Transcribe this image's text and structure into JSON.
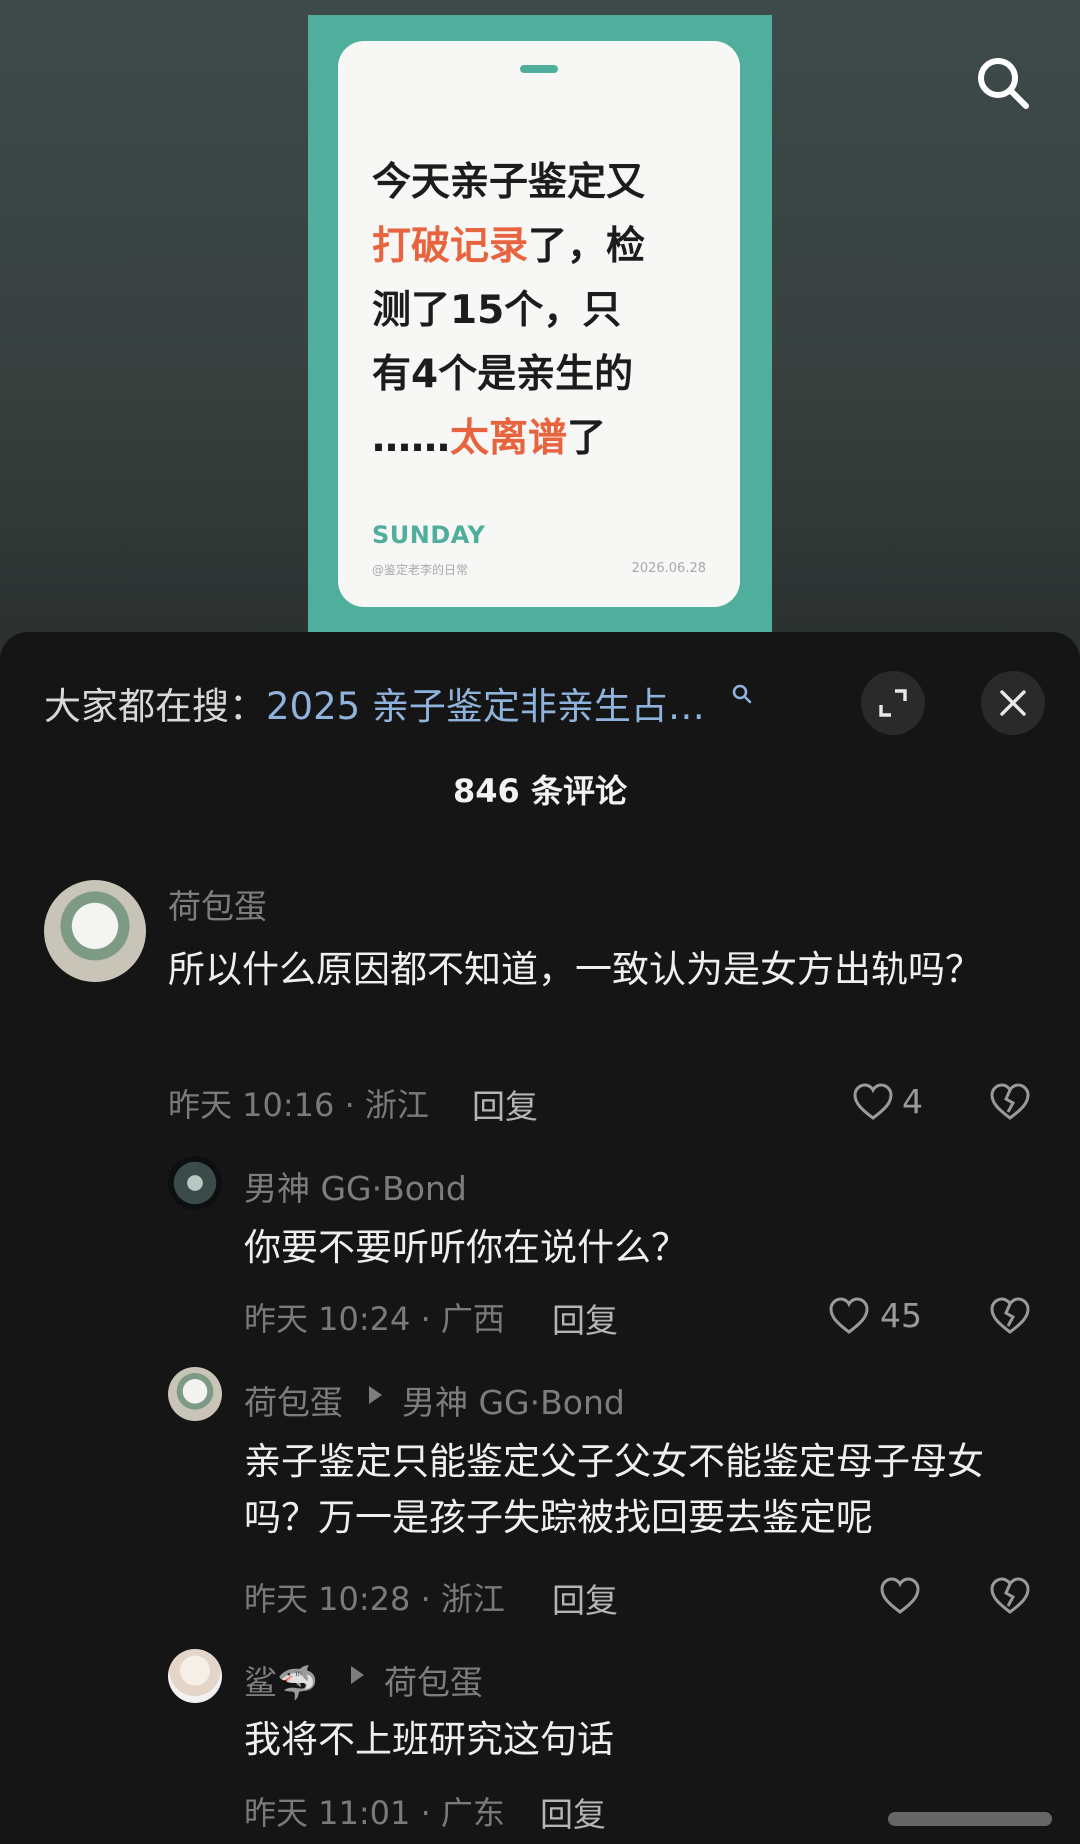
{
  "poster": {
    "line1": "今天亲子鉴定又",
    "line2_highlight": "打破记录",
    "line2_rest": "了，检",
    "line3": "测了15个，只",
    "line4": "有4个是亲生的",
    "line5_prefix": "……",
    "line5_highlight": "太离谱",
    "line5_rest": "了",
    "brand": "SUNDAY",
    "author": "@鉴定老李的日常",
    "date": "2026.06.28",
    "accent_color": "#e8643f",
    "frame_color": "#4fae9c"
  },
  "top_bar": {
    "search_icon": "search-icon"
  },
  "sheet": {
    "hot_search_prefix": "大家都在搜：",
    "hot_search_query": "2025 亲子鉴定非亲生占…",
    "expand_icon": "expand-icon",
    "close_icon": "close-icon",
    "comment_count": "846 条评论"
  },
  "comments": [
    {
      "name": "荷包蛋",
      "text": "所以什么原因都不知道，一致认为是女方出轨吗？",
      "time_location": "昨天 10:16 · 浙江",
      "reply_label": "回复",
      "likes": "4"
    },
    {
      "name": "男神 GG·Bond",
      "text": "你要不要听听你在说什么？",
      "time_location": "昨天 10:24 · 广西",
      "reply_label": "回复",
      "likes": "45"
    },
    {
      "name": "荷包蛋",
      "reply_to": "男神 GG·Bond",
      "text": "亲子鉴定只能鉴定父子父女不能鉴定母子母女吗？万一是孩子失踪被找回要去鉴定呢",
      "time_location": "昨天 10:28 · 浙江",
      "reply_label": "回复",
      "likes": ""
    },
    {
      "name": "鲨🦈",
      "reply_to": "荷包蛋",
      "text": "我将不上班研究这句话",
      "time_location": "昨天 11:01 · 广东",
      "reply_label": "回复"
    }
  ]
}
